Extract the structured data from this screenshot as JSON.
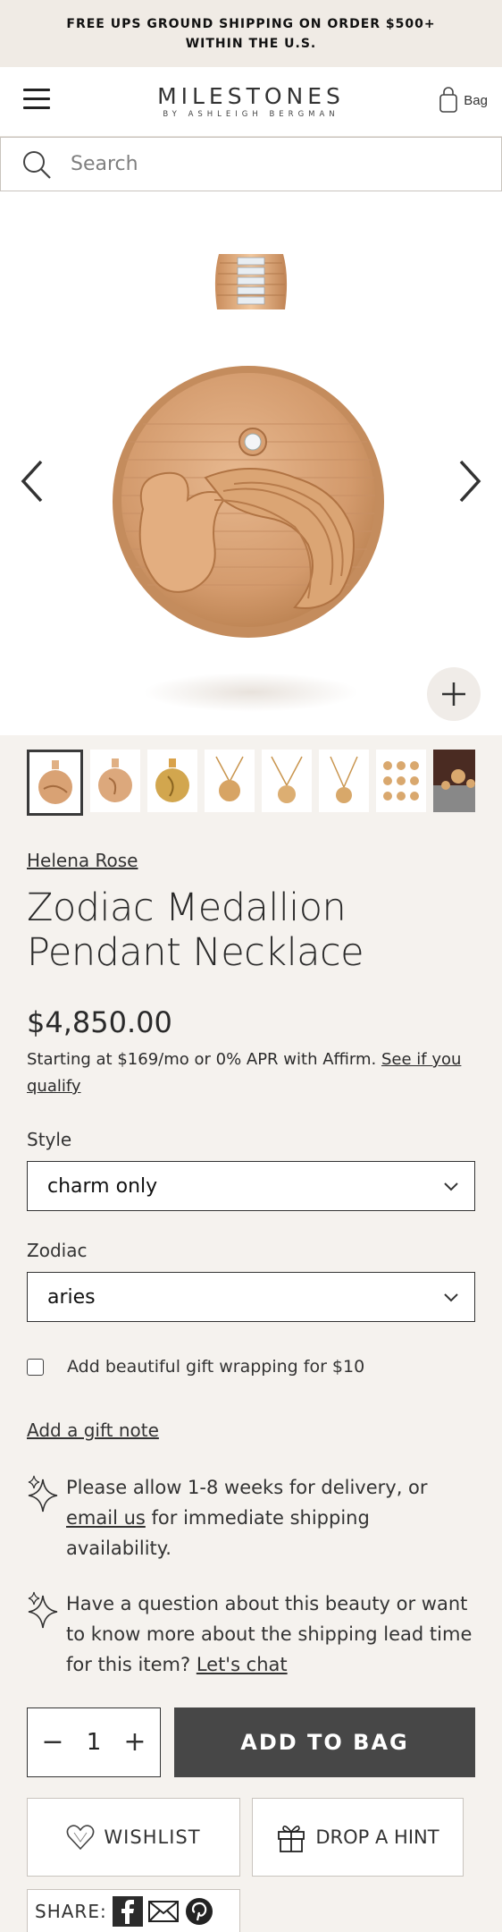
{
  "announcement": "FREE UPS GROUND SHIPPING ON ORDER $500+ WITHIN THE U.S.",
  "header": {
    "logo_main": "MILESTONES",
    "logo_sub": "BY ASHLEIGH BERGMAN",
    "bag_label": "Bag"
  },
  "search": {
    "placeholder": "Search"
  },
  "product": {
    "brand": "Helena Rose",
    "title": "Zodiac Medallion Pendant Necklace",
    "price": "$4,850.00",
    "affirm_text": "Starting at $169/mo or 0% APR with Affirm. ",
    "affirm_link": "See if you qualify"
  },
  "options": {
    "style_label": "Style",
    "style_value": "charm only",
    "zodiac_label": "Zodiac",
    "zodiac_value": "aries"
  },
  "gift_wrap_label": "Add beautiful gift wrapping for $10",
  "gift_note_link": "Add a gift note",
  "info": {
    "delivery_pre": "Please allow 1-8 weeks for delivery, or ",
    "delivery_link": "email us",
    "delivery_post": " for immediate shipping availability.",
    "question_pre": "Have a question about this beauty or want to know more about the shipping lead time for this item? ",
    "question_link": "Let's chat"
  },
  "cart": {
    "qty": "1",
    "minus": "−",
    "plus": "+",
    "add_label": "ADD TO BAG"
  },
  "buttons": {
    "wishlist": "WISHLIST",
    "hint": "DROP A HINT"
  },
  "share_label": "SHARE:",
  "colors": {
    "gold": "#d9a878",
    "gold_dark": "#b98254",
    "button_dark": "#474747",
    "page_bg": "#f5f2ee"
  }
}
